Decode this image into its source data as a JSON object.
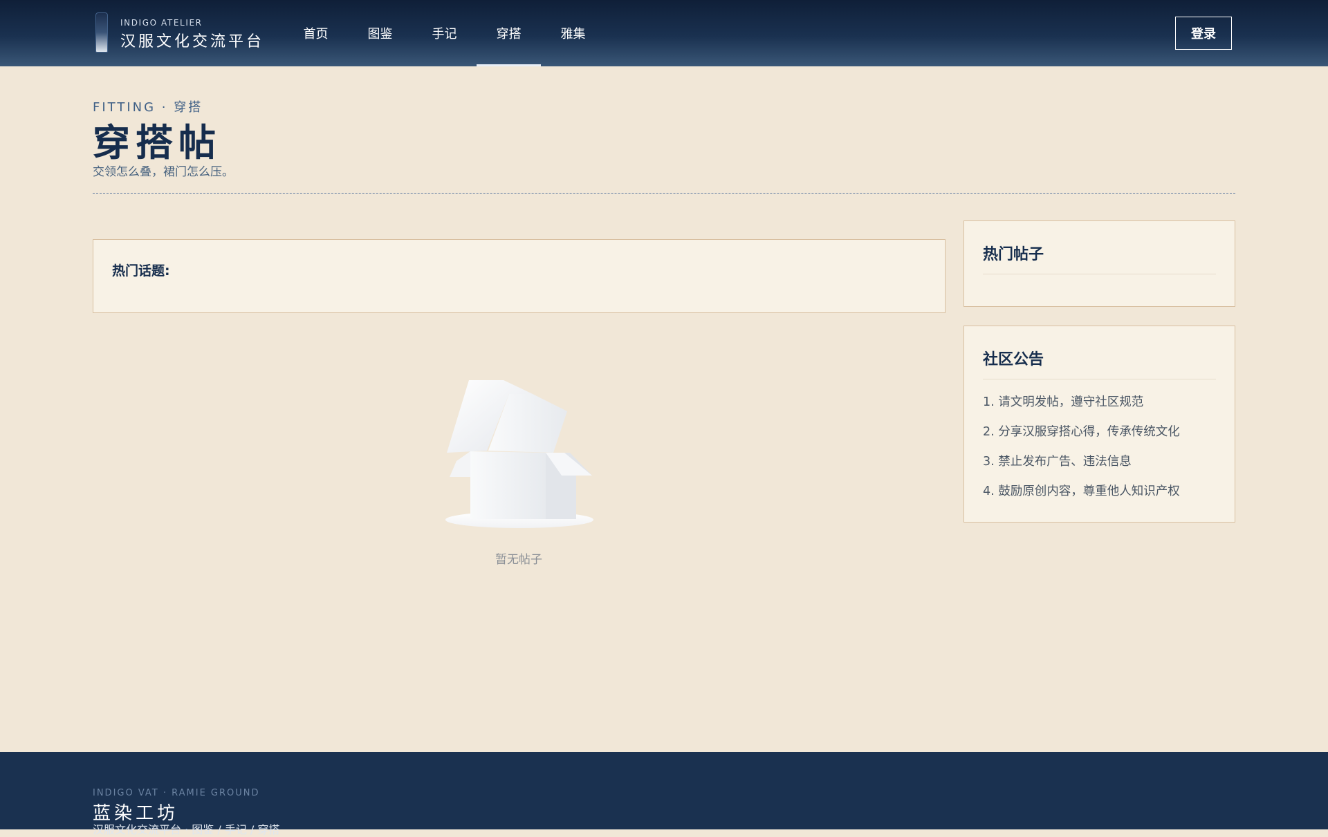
{
  "header": {
    "logo_en": "INDIGO ATELIER",
    "logo_cn": "汉服文化交流平台",
    "nav": [
      {
        "label": "首页",
        "active": false
      },
      {
        "label": "图鉴",
        "active": false
      },
      {
        "label": "手记",
        "active": false
      },
      {
        "label": "穿搭",
        "active": true
      },
      {
        "label": "雅集",
        "active": false
      }
    ],
    "login_label": "登录"
  },
  "page": {
    "eyebrow": "FITTING · 穿搭",
    "title": "穿搭帖",
    "subtitle": "交领怎么叠，裙门怎么压。"
  },
  "topics": {
    "label": "热门话题:"
  },
  "empty_state": {
    "text": "暂无帖子",
    "icon": "empty-box-icon"
  },
  "sidebar": {
    "hot_posts_title": "热门帖子",
    "notice_title": "社区公告",
    "notices": [
      "1. 请文明发帖，遵守社区规范",
      "2. 分享汉服穿搭心得，传承传统文化",
      "3. 禁止发布广告、违法信息",
      "4. 鼓励原创内容，尊重他人知识产权"
    ]
  },
  "footer": {
    "en": "INDIGO VAT · RAMIE GROUND",
    "cn": "蓝染工坊",
    "links": "汉服文化交流平台 · 图鉴 / 手记 / 穿搭"
  },
  "colors": {
    "background": "#f1e7d7",
    "header": "#1a3150",
    "accent": "#162d4d",
    "card": "#f8f2e6",
    "card_border": "#d8bfa0"
  }
}
